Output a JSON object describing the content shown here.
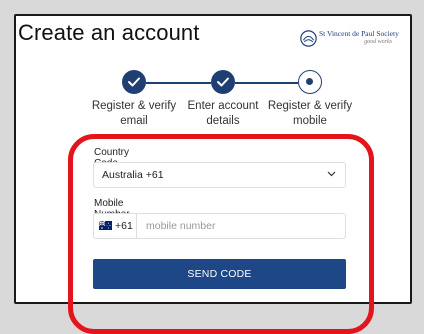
{
  "header": {
    "title": "Create an account",
    "logo_name": "St Vincent de Paul Society",
    "logo_tagline": "good works"
  },
  "stepper": {
    "steps": [
      {
        "label_line1": "Register & verify",
        "label_line2": "email",
        "state": "complete"
      },
      {
        "label_line1": "Enter account",
        "label_line2": "details",
        "state": "complete"
      },
      {
        "label_line1": "Register & verify",
        "label_line2": "mobile",
        "state": "current"
      }
    ]
  },
  "form": {
    "country_label": "Country Code",
    "country_value": "Australia +61",
    "mobile_label": "Mobile Number",
    "prefix": "+61",
    "mobile_placeholder": "mobile number",
    "mobile_value": "",
    "submit_label": "SEND CODE"
  },
  "colors": {
    "primary": "#1d4787",
    "stepper": "#1f3f73",
    "highlight": "#e3141b"
  },
  "icons": {
    "logo": "svdp-logo-icon",
    "step_check": "check-icon",
    "select": "chevron-down-icon",
    "flag": "australia-flag-icon"
  }
}
